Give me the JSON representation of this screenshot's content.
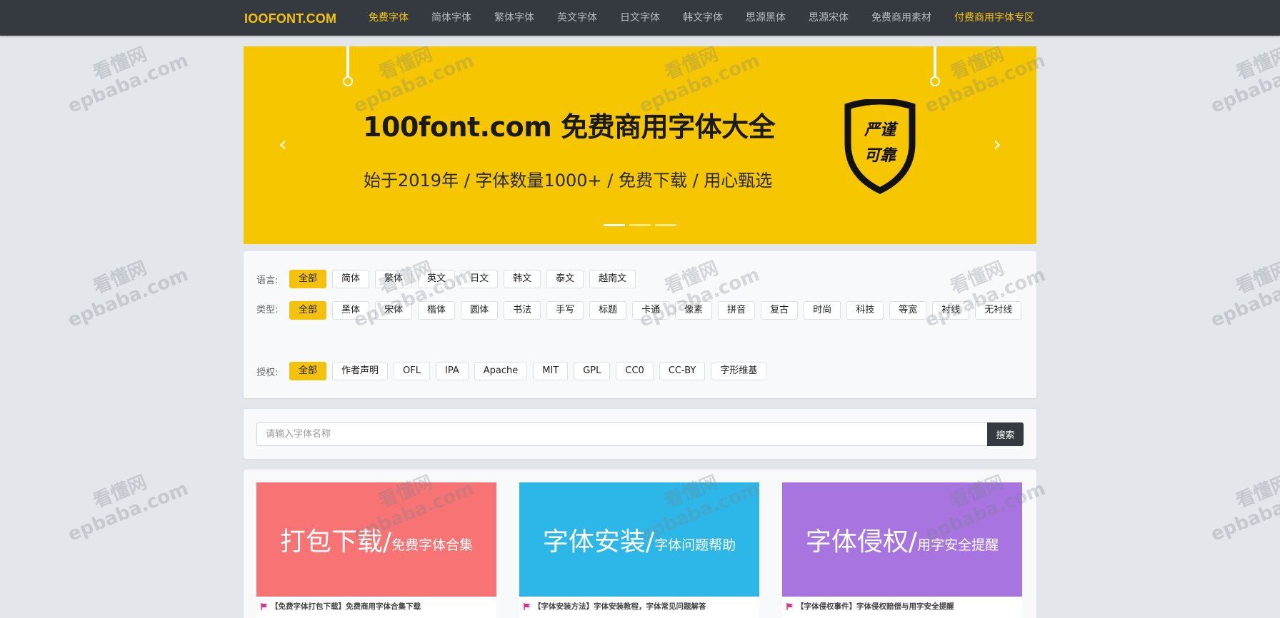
{
  "nav": {
    "brand": "IOOFONT.COM",
    "links": [
      {
        "label": "免费字体"
      },
      {
        "label": "简体字体"
      },
      {
        "label": "繁体字体"
      },
      {
        "label": "英文字体"
      },
      {
        "label": "日文字体"
      },
      {
        "label": "韩文字体"
      },
      {
        "label": "思源黑体"
      },
      {
        "label": "思源宋体"
      },
      {
        "label": "免费商用素材"
      },
      {
        "label": "付费商用字体专区"
      }
    ]
  },
  "banner": {
    "title": "100font.com 免费商用字体大全",
    "subtitle": "始于2019年 / 字体数量1000+ / 免费下载 / 用心甄选",
    "badge_line1": "严谨",
    "badge_line2": "可靠",
    "prev_icon": "chevron-left-icon",
    "next_icon": "chevron-right-icon",
    "prev_glyph": "‹",
    "next_glyph": "›"
  },
  "filters": {
    "language": {
      "label": "语言:",
      "options": [
        "全部",
        "简体",
        "繁体",
        "英文",
        "日文",
        "韩文",
        "泰文",
        "越南文"
      ]
    },
    "type": {
      "label": "类型:",
      "options": [
        "全部",
        "黑体",
        "宋体",
        "楷体",
        "圆体",
        "书法",
        "手写",
        "标题",
        "卡通",
        "像素",
        "拼音",
        "复古",
        "时尚",
        "科技",
        "等宽",
        "衬线",
        "无衬线"
      ]
    },
    "license": {
      "label": "授权:",
      "options": [
        "全部",
        "作者声明",
        "OFL",
        "IPA",
        "Apache",
        "MIT",
        "GPL",
        "CC0",
        "CC-BY",
        "字形维基"
      ]
    }
  },
  "search": {
    "placeholder": "请输入字体名称",
    "button": "搜索"
  },
  "cards": [
    {
      "big": "打包下载/",
      "small": "免费字体合集",
      "caption": "【免费字体打包下载】免费商用字体合集下载",
      "color": "#f87474"
    },
    {
      "big": "字体安装/",
      "small": "字体问题帮助",
      "caption": "【字体安装方法】字体安装教程，字体常见问题解答",
      "color": "#2db7e8"
    },
    {
      "big": "字体侵权/",
      "small": "用字安全提醒",
      "caption": "【字体侵权事件】字体侵权赔偿与用字安全提醒",
      "color": "#a875e0"
    }
  ],
  "watermark": {
    "cn": "看懂网",
    "en": "epbaba.com"
  },
  "colors": {
    "accent": "#f4c20d",
    "nav_bg": "#343a40",
    "flag": "#e0308a"
  }
}
